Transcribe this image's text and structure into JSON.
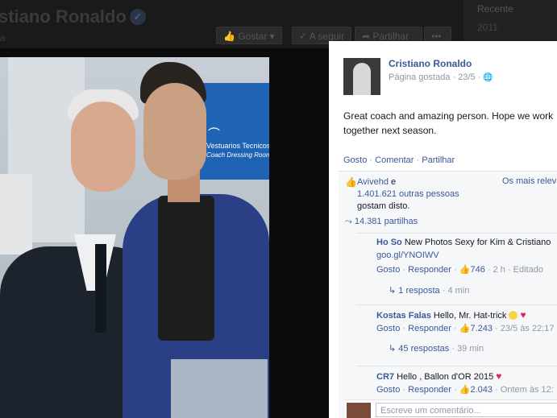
{
  "background_page": {
    "title": "stiano Ronaldo",
    "subtitle": "a",
    "buttons": {
      "like": "Gostar",
      "follow": "A seguir",
      "share": "Partilhar",
      "more": "•••"
    },
    "sidebar": {
      "label": "Recente",
      "year": "2011"
    }
  },
  "photo": {
    "sign_line1": "Vestuarios Tecnicos",
    "sign_line2": "Coach Dressing Room"
  },
  "post": {
    "author": "Cristiano Ronaldo",
    "meta": "Página gostada · 23/5 ·",
    "text": "Great coach and amazing person. Hope we work together next season.",
    "actions": {
      "like": "Gosto",
      "comment": "Comentar",
      "share": "Partilhar"
    }
  },
  "feedback": {
    "likes_name": "Avivehd",
    "likes_connector": " e",
    "likes_count": "1.401.621 outras pessoas",
    "likes_suffix": "gostam disto.",
    "most_relevant": "Os mais releva",
    "shares": "14.381 partilhas"
  },
  "comments": [
    {
      "author": "Ho So",
      "text": " New Photos Sexy for Kim & Cristiano",
      "link": "goo.gl/YNOIWV",
      "like": "Gosto",
      "reply": "Responder",
      "count": "746",
      "time": "· 2 h · Editado",
      "replies": "1 resposta",
      "replies_time": "· 4 min"
    },
    {
      "author": "Kostas Falas",
      "text": " Hello, Mr. Hat-trick",
      "like": "Gosto",
      "reply": "Responder",
      "count": "7.243",
      "time": "· 23/5 às 22:17",
      "replies": "45 respostas",
      "replies_time": "· 39 min"
    },
    {
      "author": "CR7",
      "text": " Hello , Ballon d'OR 2015",
      "like": "Gosto",
      "reply": "Responder",
      "count": "2.043",
      "time": "· Ontem às 12:"
    }
  ],
  "compose": {
    "placeholder": "Escreve um comentário..."
  },
  "colors": {
    "link": "#3b5998",
    "panel": "#ffffff",
    "feedback_bg": "#f6f7f9",
    "overlay": "#0c0c0c"
  },
  "icons": [
    "verified-icon",
    "like-icon",
    "share-icon",
    "thumbs-up-icon",
    "reply-arrow-icon",
    "globe-icon",
    "heart-icon",
    "smile-icon"
  ]
}
